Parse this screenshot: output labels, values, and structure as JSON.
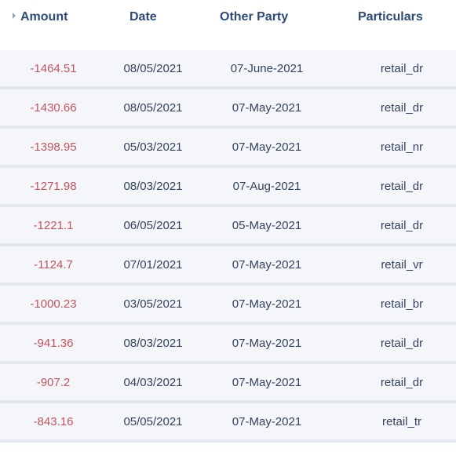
{
  "columns": {
    "amount": "Amount",
    "date": "Date",
    "other_party": "Other Party",
    "particulars": "Particulars"
  },
  "rows": [
    {
      "amount": "-1464.51",
      "date": "08/05/2021",
      "other_party": "07-June-2021",
      "particulars": "retail_dr"
    },
    {
      "amount": "-1430.66",
      "date": "08/05/2021",
      "other_party": "07-May-2021",
      "particulars": "retail_dr"
    },
    {
      "amount": "-1398.95",
      "date": "05/03/2021",
      "other_party": "07-May-2021",
      "particulars": "retail_nr"
    },
    {
      "amount": "-1271.98",
      "date": "08/03/2021",
      "other_party": "07-Aug-2021",
      "particulars": "retail_dr"
    },
    {
      "amount": "-1221.1",
      "date": "06/05/2021",
      "other_party": "05-May-2021",
      "particulars": "retail_dr"
    },
    {
      "amount": "-1124.7",
      "date": "07/01/2021",
      "other_party": "07-May-2021",
      "particulars": "retail_vr"
    },
    {
      "amount": "-1000.23",
      "date": "03/05/2021",
      "other_party": "07-May-2021",
      "particulars": "retail_br"
    },
    {
      "amount": "-941.36",
      "date": "08/03/2021",
      "other_party": "07-May-2021",
      "particulars": "retail_dr"
    },
    {
      "amount": "-907.2",
      "date": "04/03/2021",
      "other_party": "07-May-2021",
      "particulars": "retail_dr"
    },
    {
      "amount": "-843.16",
      "date": "05/05/2021",
      "other_party": "07-May-2021",
      "particulars": "retail_tr"
    }
  ],
  "icons": {
    "sort": "sort-indicator-icon"
  },
  "colors": {
    "header_text": "#2c4a7a",
    "amount_negative": "#c2545f",
    "row_background": "#f5f6fa",
    "row_divider": "#e3e7ef"
  }
}
